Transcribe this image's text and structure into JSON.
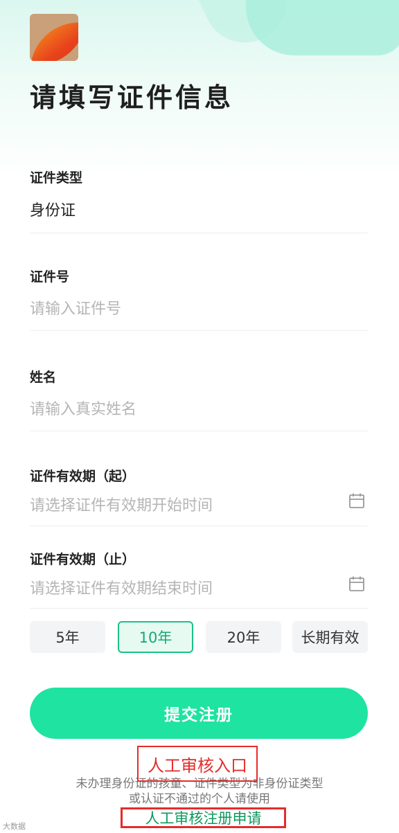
{
  "title": "请填写证件信息",
  "fields": {
    "id_type": {
      "label": "证件类型",
      "value": "身份证"
    },
    "id_number": {
      "label": "证件号",
      "placeholder": "请输入证件号"
    },
    "name": {
      "label": "姓名",
      "placeholder": "请输入真实姓名"
    },
    "valid_start": {
      "label": "证件有效期（起）",
      "placeholder": "请选择证件有效期开始时间"
    },
    "valid_end": {
      "label": "证件有效期（止）",
      "placeholder": "请选择证件有效期结束时间"
    }
  },
  "duration_chips": [
    {
      "label": "5年",
      "selected": false
    },
    {
      "label": "10年",
      "selected": true
    },
    {
      "label": "20年",
      "selected": false
    },
    {
      "label": "长期有效",
      "selected": false
    }
  ],
  "submit_label": "提交注册",
  "hint": {
    "line1": "未办理身份证的孩童、证件类型为非身份证类型",
    "line2": "或认证不通过的个人请使用",
    "link": "人工审核注册申请"
  },
  "annotation_label": "人工审核入口",
  "watermark": "大数据",
  "colors": {
    "accent": "#1fe3a0",
    "selected": "#19c188",
    "annotation": "#e52b2b"
  }
}
